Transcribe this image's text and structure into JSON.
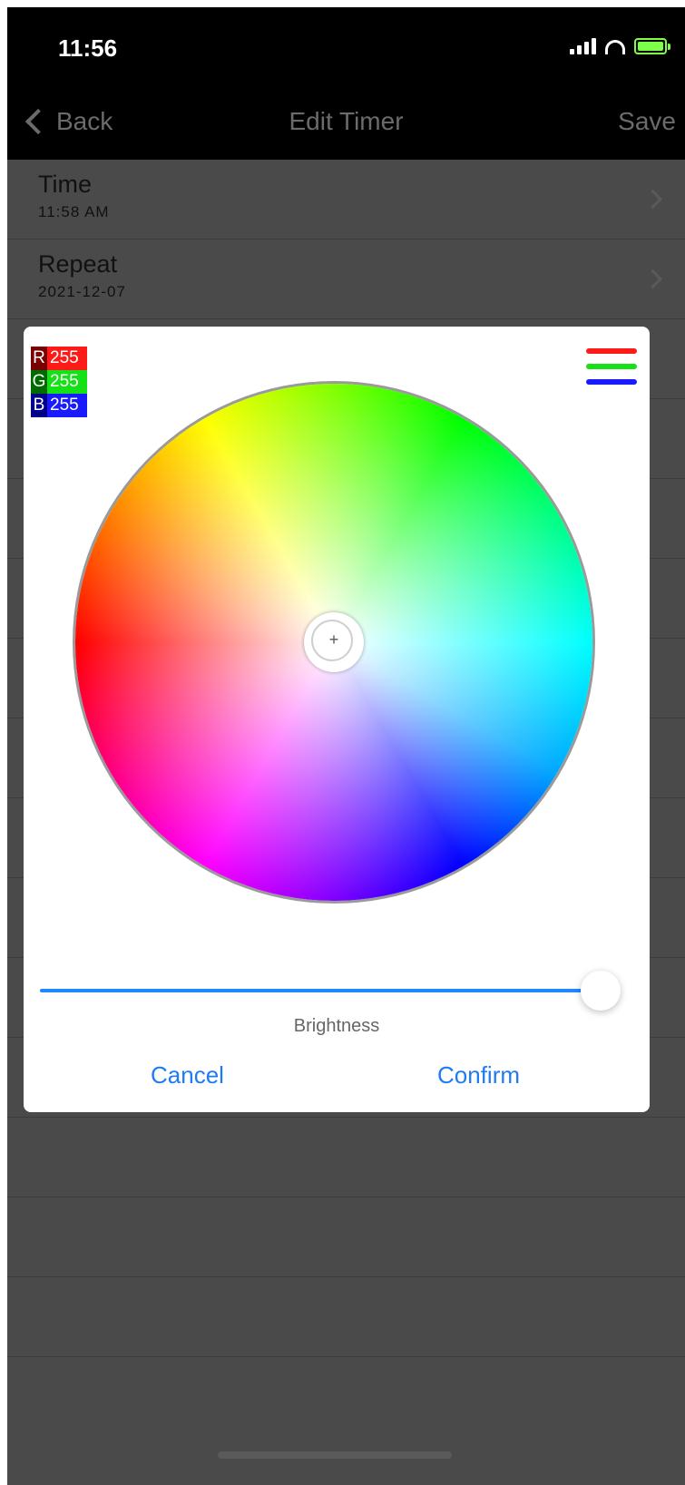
{
  "status_bar": {
    "time": "11:56"
  },
  "nav": {
    "back_label": "Back",
    "title": "Edit Timer",
    "save_label": "Save"
  },
  "rows": [
    {
      "label": "Time",
      "value": "11:58 AM"
    },
    {
      "label": "Repeat",
      "value": "2021-12-07"
    }
  ],
  "color_picker": {
    "rgb": {
      "r_label": "R",
      "r_value": "255",
      "g_label": "G",
      "g_value": "255",
      "b_label": "B",
      "b_value": "255"
    },
    "brightness_level": 1.0,
    "brightness_label": "Brightness",
    "cancel_label": "Cancel",
    "confirm_label": "Confirm"
  },
  "colors": {
    "accent": "#1e7bf5",
    "background": "#4a4a4a",
    "bar": "#000000"
  }
}
